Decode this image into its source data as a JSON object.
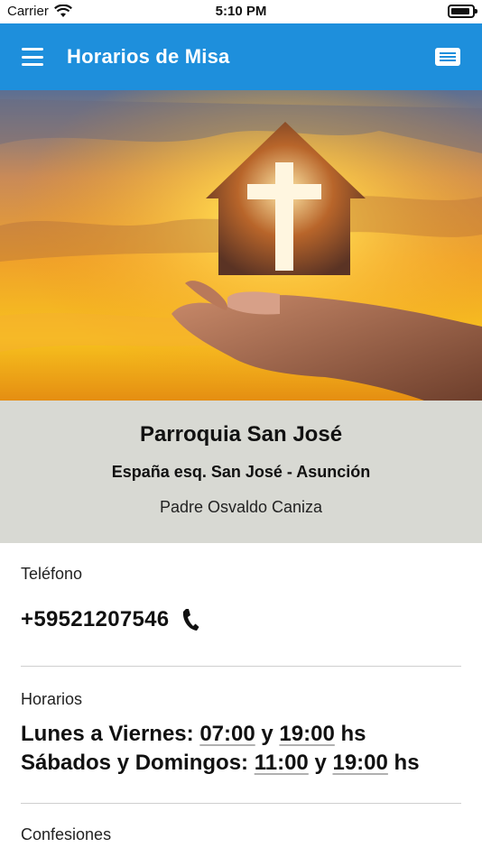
{
  "status_bar": {
    "carrier": "Carrier",
    "time": "5:10 PM",
    "battery_level": 0.9
  },
  "app_bar": {
    "title": "Horarios de Misa",
    "menu_icon": "hamburger-menu-icon",
    "message_icon": "message-icon",
    "color": "#1e8fdc"
  },
  "parish": {
    "name": "Parroquia San José",
    "address": "España esq. San José - Asunción",
    "priest": "Padre Osvaldo Caniza"
  },
  "contact": {
    "phone_label": "Teléfono",
    "phone": "+59521207546"
  },
  "schedule": {
    "label": "Horarios",
    "weekdays_label": "Lunes a Viernes:",
    "weekdays_times": [
      "07:00",
      "19:00"
    ],
    "weekend_label": "Sábados y Domingos:",
    "weekend_times": [
      "11:00",
      "19:00"
    ],
    "connector": "y",
    "suffix": "hs"
  },
  "confessions": {
    "label": "Confesiones"
  }
}
